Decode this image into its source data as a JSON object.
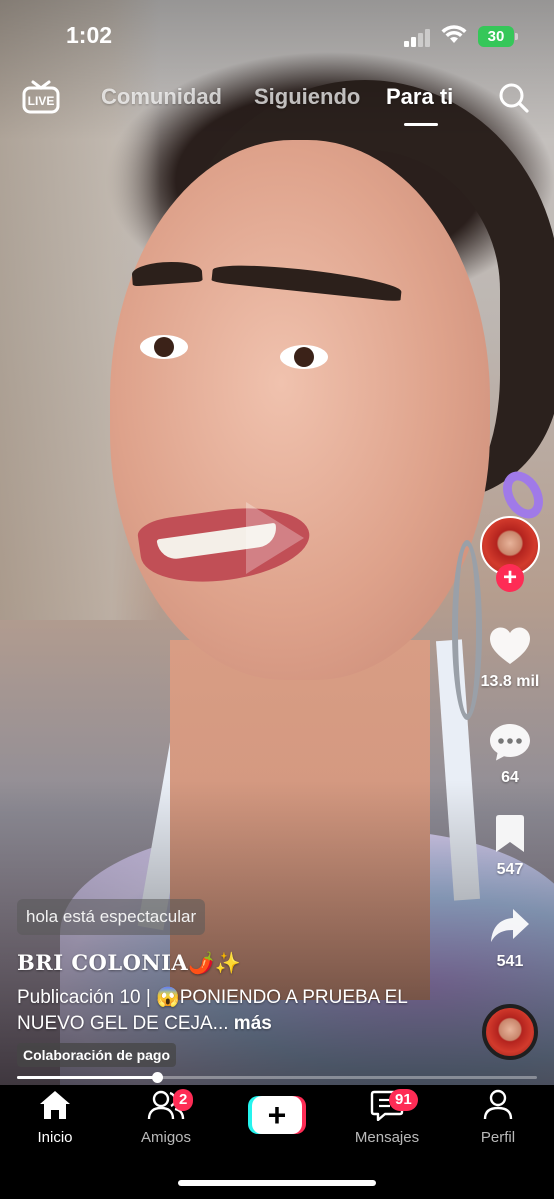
{
  "status_bar": {
    "time": "1:02",
    "battery": "30"
  },
  "top_nav": {
    "live_icon": "live-tv-icon",
    "tabs": [
      {
        "label": "Comunidad",
        "active": false
      },
      {
        "label": "Siguiendo",
        "active": false
      },
      {
        "label": "Para ti",
        "active": true
      }
    ],
    "search_icon": "search-icon"
  },
  "video": {
    "comment_preview": "hola está espectacular",
    "username": "BRI COLONIA",
    "username_emojis": "🌶️✨",
    "caption": "Publicación 10 | 😱PONIENDO A PRUEBA EL NUEVO GEL DE CEJA...",
    "caption_more": "más",
    "paid_label": "Colaboración de pago",
    "progress_fraction": 0.27
  },
  "actions": {
    "likes": "13.8 mil",
    "comments": "64",
    "bookmarks": "547",
    "shares": "541"
  },
  "bottom_nav": {
    "items": [
      {
        "label": "Inicio",
        "icon": "home-icon"
      },
      {
        "label": "Amigos",
        "icon": "friends-icon",
        "badge": "2"
      },
      {
        "label": "",
        "icon": "create-plus-icon"
      },
      {
        "label": "Mensajes",
        "icon": "inbox-icon",
        "badge": "91"
      },
      {
        "label": "Perfil",
        "icon": "profile-icon"
      }
    ]
  },
  "colors": {
    "accent": "#fe2c55",
    "cyan": "#25f4ee",
    "battery_green": "#35c759"
  }
}
